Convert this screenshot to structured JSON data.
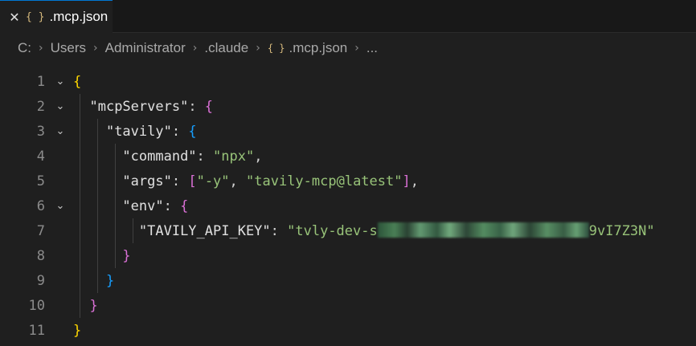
{
  "tab": {
    "close": "✕",
    "icon": "{ }",
    "label": ".mcp.json"
  },
  "breadcrumb": {
    "items": [
      "C:",
      "Users",
      "Administrator",
      ".claude"
    ],
    "file_icon": "{ }",
    "file": ".mcp.json",
    "more": "..."
  },
  "lines": [
    {
      "n": "1",
      "parts": [
        "{"
      ]
    },
    {
      "n": "2",
      "parts": [
        "\"mcpServers\"",
        ": ",
        "{"
      ]
    },
    {
      "n": "3",
      "parts": [
        "\"tavily\"",
        ": ",
        "{"
      ]
    },
    {
      "n": "4",
      "parts": [
        "\"command\"",
        ": ",
        "\"npx\"",
        ","
      ]
    },
    {
      "n": "5",
      "parts": [
        "\"args\"",
        ": ",
        "[",
        "\"-y\"",
        ", ",
        "\"tavily-mcp@latest\"",
        "]",
        ","
      ]
    },
    {
      "n": "6",
      "parts": [
        "\"env\"",
        ": ",
        "{"
      ]
    },
    {
      "n": "7",
      "parts": [
        "\"TAVILY_API_KEY\"",
        ": ",
        "\"tvly-dev-s",
        "9vI7Z3N\""
      ]
    },
    {
      "n": "8",
      "parts": [
        "}"
      ]
    },
    {
      "n": "9",
      "parts": [
        "}"
      ]
    },
    {
      "n": "10",
      "parts": [
        "}"
      ]
    },
    {
      "n": "11",
      "parts": [
        "}"
      ]
    }
  ],
  "fold_icon": "chevron-down-icon",
  "colors": {
    "background": "#1f1f1f",
    "string": "#98c379",
    "bracket_level1": "#ffd700",
    "bracket_level2": "#da70d6",
    "bracket_level3": "#179fff",
    "tab_accent": "#0078d4"
  }
}
